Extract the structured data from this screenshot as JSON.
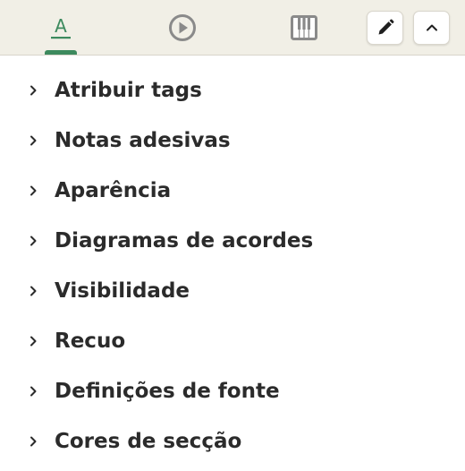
{
  "theme": {
    "accent": "#3d8a5e",
    "icon_gray": "#8a8a8a",
    "text": "#2b2b2b"
  },
  "tabs": [
    {
      "icon": "text-format-icon",
      "letter": "A",
      "selected": true
    },
    {
      "icon": "play-circle-icon",
      "selected": false
    },
    {
      "icon": "piano-keys-icon",
      "selected": false
    }
  ],
  "toolbar": {
    "edit_icon": "pencil-icon",
    "collapse_icon": "chevron-up-icon"
  },
  "menu": {
    "items": [
      {
        "label": "Atribuir tags"
      },
      {
        "label": "Notas adesivas"
      },
      {
        "label": "Aparência"
      },
      {
        "label": "Diagramas de acordes"
      },
      {
        "label": "Visibilidade"
      },
      {
        "label": "Recuo"
      },
      {
        "label": "Definições de fonte"
      },
      {
        "label": "Cores de secção"
      }
    ]
  }
}
